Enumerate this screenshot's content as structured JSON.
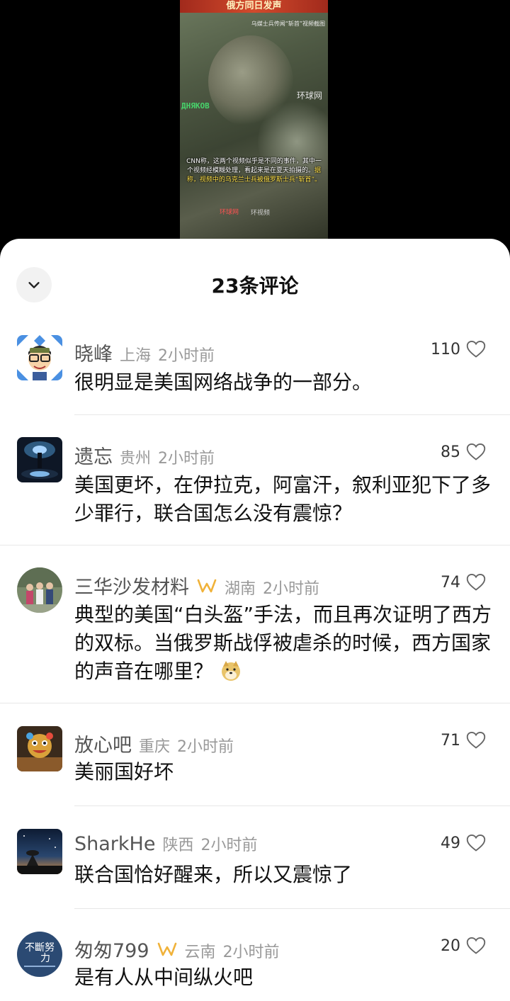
{
  "video": {
    "banner": "俄方同日发声",
    "subtag": "乌媒士兵传闻“斩首”视频截图",
    "watermark": "环球网",
    "side_text": "ДНЯКОВ",
    "caption_plain": "CNN称，这两个视频似乎是不同的事件，其中一个视频经模糊处理，看起来是在夏天拍摄的。",
    "caption_highlight": "据称，视频中的乌克兰士兵被俄罗斯士兵“斩首”。",
    "logo_left": "环球网",
    "logo_right": "环视频"
  },
  "sheet": {
    "title": "23条评论",
    "collapse_icon": "chevron-down-icon"
  },
  "comments": [
    {
      "name": "晓峰",
      "location": "上海",
      "time": "2小时前",
      "likes": "110",
      "text": "很明显是美国网络战争的一部分。",
      "vip": false
    },
    {
      "name": "遗忘",
      "location": "贵州",
      "time": "2小时前",
      "likes": "85",
      "text": "美国更坏，在伊拉克，阿富汗，叙利亚犯下了多少罪行，联合国怎么没有震惊？",
      "vip": false
    },
    {
      "name": "三华沙发材料",
      "location": "湖南",
      "time": "2小时前",
      "likes": "74",
      "text": "典型的美国“白头盔”手法，而且再次证明了西方的双标。当俄罗斯战俘被虐杀的时候，西方国家的声音在哪里？",
      "vip": true
    },
    {
      "name": "放心吧",
      "location": "重庆",
      "time": "2小时前",
      "likes": "71",
      "text": "美丽国好坏",
      "vip": false
    },
    {
      "name": "SharkHe",
      "location": "陕西",
      "time": "2小时前",
      "likes": "49",
      "text": "联合国恰好醒来，所以又震惊了",
      "vip": false
    },
    {
      "name": "匆匆799",
      "location": "云南",
      "time": "2小时前",
      "likes": "20",
      "text": "是有人从中间纵火吧",
      "vip": true
    }
  ],
  "colors": {
    "vip_badge": "#f0b23a",
    "name": "#555555",
    "meta": "#999999"
  }
}
